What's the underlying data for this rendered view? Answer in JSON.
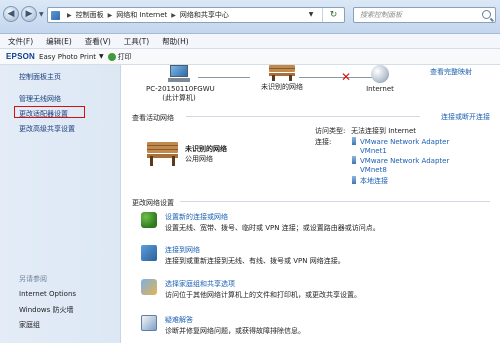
{
  "address_bar": {
    "crumbs": [
      "控制面板",
      "网络和 Internet",
      "网络和共享中心"
    ],
    "search_placeholder": "搜索控制面板"
  },
  "menu": [
    "文件(F)",
    "编辑(E)",
    "查看(V)",
    "工具(T)",
    "帮助(H)"
  ],
  "epson_bar": {
    "logo": "EPSON",
    "app": "Easy Photo Print",
    "print": "打印"
  },
  "sidebar": {
    "items": [
      "控制面板主页",
      "管理无线网络",
      "更改适配器设置",
      "更改高级共享设置"
    ],
    "see_also_title": "另请参阅",
    "see_also": [
      "Internet Options",
      "Windows 防火墙",
      "家庭组"
    ]
  },
  "network_map": {
    "view_full_map": "查看完整映射",
    "computer_name": "PC-20150110FGWU",
    "computer_sub": "(此计算机)",
    "middle_label": "未识别的网络",
    "internet_label": "Internet"
  },
  "active_networks": {
    "title": "查看活动网络",
    "connect_link": "连接或断开连接",
    "network_name": "未识别的网络",
    "network_type": "公用网络",
    "access_type_label": "访问类型:",
    "access_type_value": "无法连接到 Internet",
    "connections_label": "连接:",
    "adapters": [
      "VMware Network Adapter VMnet1",
      "VMware Network Adapter VMnet8",
      "本地连接"
    ],
    "adapter_lines": [
      [
        "VMware Network Adapter",
        "VMnet1"
      ],
      [
        "VMware Network Adapter",
        "VMnet8"
      ],
      [
        "本地连接"
      ]
    ]
  },
  "change_settings": {
    "title": "更改网络设置",
    "tasks": [
      {
        "title": "设置新的连接或网络",
        "desc": "设置无线、宽带、拨号、临时或 VPN 连接；或设置路由器或访问点。"
      },
      {
        "title": "连接到网络",
        "desc": "连接到或重新连接到无线、有线、拨号或 VPN 网络连接。"
      },
      {
        "title": "选择家庭组和共享选项",
        "desc": "访问位于其他网络计算机上的文件和打印机，或更改共享设置。"
      },
      {
        "title": "疑难解答",
        "desc": "诊断并修复网络问题，或获得故障排除信息。"
      }
    ]
  }
}
